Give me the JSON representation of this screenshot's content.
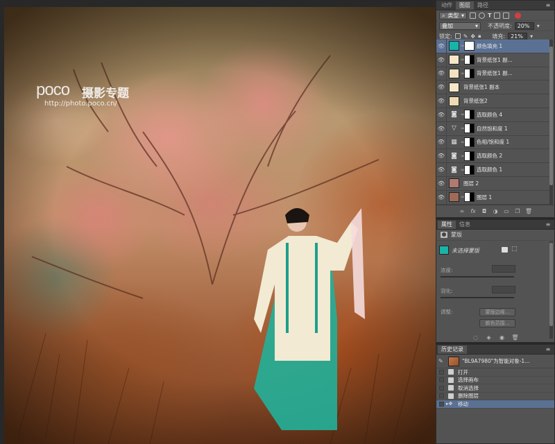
{
  "canvas": {
    "watermark_logo": "poco",
    "watermark_title": "摄影专题",
    "watermark_url": "http://photo.poco.cn/"
  },
  "layers_panel": {
    "tabs": [
      {
        "label": "动作",
        "active": false
      },
      {
        "label": "图层",
        "active": true
      },
      {
        "label": "路径",
        "active": false
      }
    ],
    "filter_kind": "类型",
    "blend_mode": "叠加",
    "opacity_label": "不透明度:",
    "opacity_value": "20%",
    "lock_label": "锁定:",
    "fill_label": "填充:",
    "fill_value": "21%",
    "layers": [
      {
        "name": "颜色填充 1",
        "kind": "fill",
        "thumb_color": "#19b3a8",
        "has_mask": true,
        "selected": true
      },
      {
        "name": "背景纸张1 副...",
        "kind": "paper",
        "thumb_color": "#f5e6c8",
        "has_mask": true,
        "selected": false
      },
      {
        "name": "背景纸张1 副...",
        "kind": "paper",
        "thumb_color": "#f3e2c0",
        "has_mask": true,
        "selected": false
      },
      {
        "name": "背景纸张1 副本",
        "kind": "paper",
        "thumb_color": "#f6e8c6",
        "has_mask": false,
        "selected": false
      },
      {
        "name": "背景纸张2",
        "kind": "paper",
        "thumb_color": "#efdcb4",
        "has_mask": false,
        "selected": false
      },
      {
        "name": "选取颜色 4",
        "kind": "adjust",
        "icon": "selective-color-icon",
        "has_mask": true,
        "selected": false
      },
      {
        "name": "自然饱和度 1",
        "kind": "adjust",
        "icon": "vibrance-icon",
        "has_mask": true,
        "selected": false
      },
      {
        "name": "色相/饱和度 1",
        "kind": "adjust",
        "icon": "hue-saturation-icon",
        "has_mask": true,
        "selected": false
      },
      {
        "name": "选取颜色 2",
        "kind": "adjust",
        "icon": "selective-color-icon",
        "has_mask": true,
        "selected": false
      },
      {
        "name": "选取颜色 1",
        "kind": "adjust",
        "icon": "selective-color-icon",
        "has_mask": true,
        "selected": false
      },
      {
        "name": "图层 2",
        "kind": "photo",
        "thumb_color": "#b07a70",
        "has_mask": false,
        "selected": false
      },
      {
        "name": "图层 1",
        "kind": "photo",
        "thumb_color": "#a06a58",
        "has_mask": true,
        "selected": false
      }
    ]
  },
  "properties_panel": {
    "tabs": [
      {
        "label": "属性",
        "active": true
      },
      {
        "label": "信息",
        "active": false
      }
    ],
    "section_title": "蒙版",
    "mask_status": "未选择蒙版",
    "density_label": "浓度:",
    "feather_label": "羽化:",
    "adjust_label": "调整:",
    "mask_edge_button": "蒙版边缘...",
    "color_range_button": "颜色范围..."
  },
  "history_panel": {
    "tab": "历史记录",
    "snapshot_label": "\"BL9A7980\"为智能对象-1...",
    "items": [
      {
        "label": "打开",
        "selected": false
      },
      {
        "label": "选择画布",
        "selected": false
      },
      {
        "label": "取消选择",
        "selected": false
      },
      {
        "label": "删除图层",
        "selected": false
      },
      {
        "label": "移动",
        "selected": true
      }
    ]
  },
  "colors": {
    "selection": "#5b7194",
    "fill_swatch": "#19b3a8",
    "panel_bg": "#535353",
    "app_bg": "#282828"
  }
}
